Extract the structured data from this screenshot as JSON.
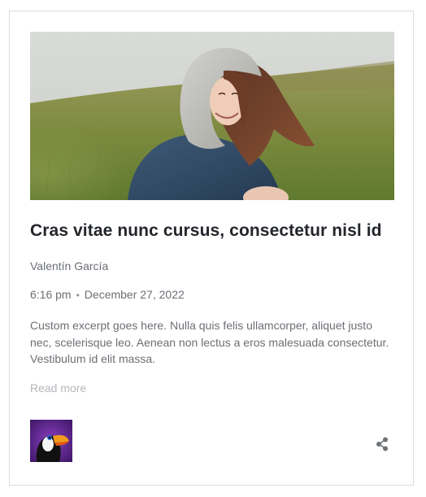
{
  "post": {
    "title": "Cras vitae nunc cursus, consectetur nisl id",
    "author": "Valentín García",
    "time": "6:16 pm",
    "separator": "•",
    "date": "December 27, 2022",
    "excerpt": "Custom excerpt goes here. Nulla quis felis ullamcorper, aliquet justo nec, scelerisque leo. Aenean non lectus a eros malesuada consectetur. Vestibulum id elit massa.",
    "read_more": "Read more"
  },
  "icons": {
    "share": "share-icon",
    "avatar": "toucan-avatar"
  },
  "colors": {
    "title": "#23262b",
    "meta": "#6b6f75",
    "read_more": "#b4b7bb",
    "border": "#dcdcdc",
    "avatar_bg": "#5a2a86"
  }
}
